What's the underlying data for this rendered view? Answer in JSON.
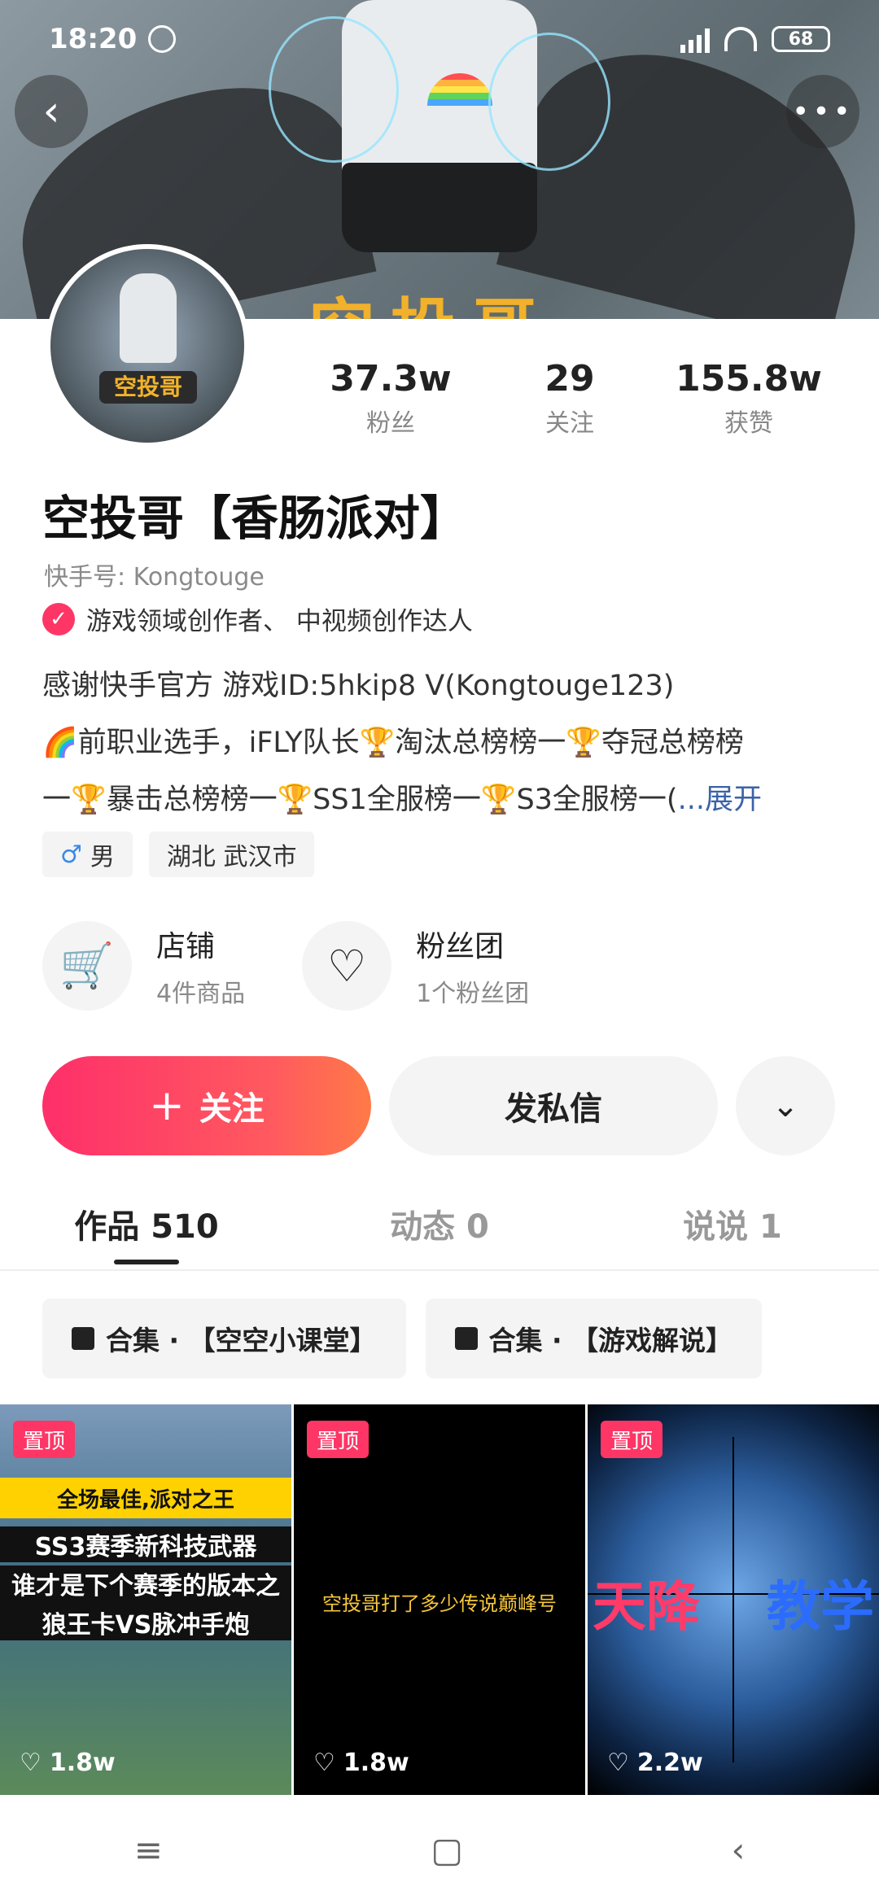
{
  "status_bar": {
    "time": "18:20",
    "battery": "68"
  },
  "banner": {
    "deco_text": "空投哥"
  },
  "avatar": {
    "tag": "空投哥"
  },
  "stats": [
    {
      "value": "37.3w",
      "label": "粉丝"
    },
    {
      "value": "29",
      "label": "关注"
    },
    {
      "value": "155.8w",
      "label": "获赞"
    }
  ],
  "profile": {
    "name": "空投哥【香肠派对】",
    "kuaishou_id": "快手号: Kongtouge",
    "verify_text": "游戏领域创作者、 中视频创作达人",
    "bio_line1": "感谢快手官方 游戏ID:5hkip8 V(Kongtouge123)",
    "bio_line2": "🌈前职业选手，iFLY队长🏆淘汰总榜榜一🏆夺冠总榜榜",
    "bio_line3": "一🏆暴击总榜榜一🏆SS1全服榜一🏆S3全服榜一(",
    "bio_expand": "...展开",
    "gender": "男",
    "location": "湖北 武汉市"
  },
  "shop": {
    "title": "店铺",
    "sub": "4件商品"
  },
  "fans_club": {
    "title": "粉丝团",
    "sub": "1个粉丝团"
  },
  "actions": {
    "follow": "关注",
    "message": "发私信"
  },
  "tabs": [
    {
      "label": "作品 510"
    },
    {
      "label": "动态 0"
    },
    {
      "label": "说说 1"
    }
  ],
  "collections": [
    {
      "label": "合集 · 【空空小课堂】"
    },
    {
      "label": "合集 · 【游戏解说】"
    }
  ],
  "videos": [
    {
      "pin": "置顶",
      "likes": "1.8w",
      "caption_band": "全场最佳,派对之王",
      "caption_1": "SS3赛季新科技武器",
      "caption_2": "谁才是下个赛季的版本之子",
      "caption_3": "狼王卡VS脉冲手炮"
    },
    {
      "pin": "置顶",
      "likes": "1.8w",
      "caption": "空投哥打了多少传说巅峰号"
    },
    {
      "pin": "置顶",
      "likes": "2.2w",
      "caption_a": "天降",
      "caption_b": "教学"
    }
  ],
  "colors": {
    "accent": "#fe3666",
    "link": "#3a62a8"
  }
}
